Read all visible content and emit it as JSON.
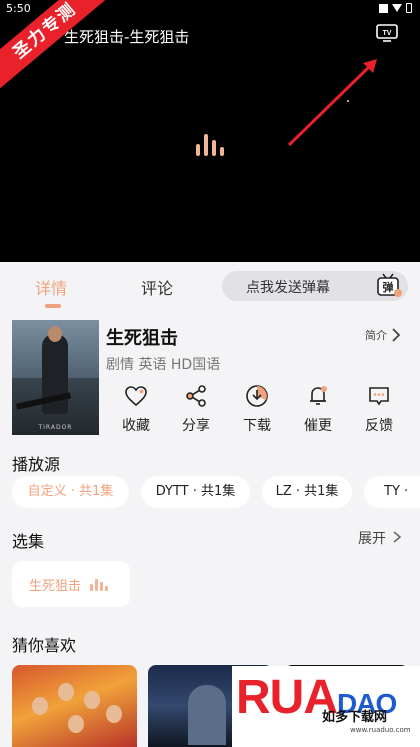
{
  "status_bar": {
    "time": "5:50"
  },
  "player": {
    "title": "生死狙击-生死狙击",
    "watermark": "圣力专测",
    "tv_icon": "tv-cast-icon"
  },
  "tabs": [
    {
      "label": "详情",
      "active": true
    },
    {
      "label": "评论",
      "active": false
    }
  ],
  "danmu": {
    "placeholder": "点我发送弹幕",
    "icon_text": "弹"
  },
  "movie": {
    "title": "生死狙击",
    "tags": "剧情 英语 HD国语",
    "intro_label": "简介",
    "poster_text": "TIRADOR"
  },
  "actions": [
    {
      "label": "收藏",
      "icon": "heart-icon"
    },
    {
      "label": "分享",
      "icon": "share-icon"
    },
    {
      "label": "下载",
      "icon": "download-icon"
    },
    {
      "label": "催更",
      "icon": "bell-icon"
    },
    {
      "label": "反馈",
      "icon": "feedback-icon"
    }
  ],
  "sources": {
    "title": "播放源",
    "items": [
      {
        "label": "自定义 · 共1集",
        "active": true
      },
      {
        "label": "DYTT · 共1集",
        "active": false
      },
      {
        "label": "LZ · 共1集",
        "active": false
      },
      {
        "label": "TY ·",
        "active": false
      }
    ]
  },
  "episodes": {
    "title": "选集",
    "expand_label": "展开",
    "items": [
      {
        "label": "生死狙击",
        "playing": true
      }
    ]
  },
  "recommend": {
    "title": "猜你喜欢"
  },
  "brand": {
    "name_part1": "RUA",
    "name_part2": "DAO",
    "subtitle": "如多下载网",
    "url": "www.ruaduo.com"
  },
  "colors": {
    "accent": "#f0a27d",
    "watermark_red": "#e8212b",
    "page_bg": "#f4f4f6"
  }
}
